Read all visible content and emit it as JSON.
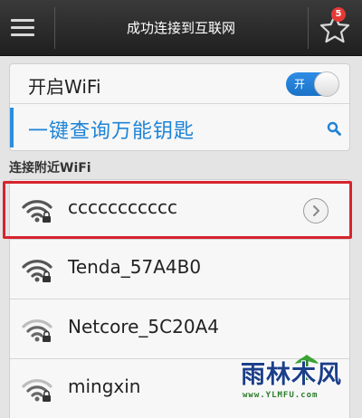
{
  "header": {
    "title": "成功连接到互联网",
    "favorites_count": "5"
  },
  "wifi_toggle": {
    "label": "开启WiFi",
    "state_text": "开",
    "enabled": true
  },
  "query": {
    "label": "一键查询万能钥匙"
  },
  "section": {
    "nearby_label": "连接附近WiFi"
  },
  "networks": [
    {
      "name": "ccccccccccc",
      "locked": true,
      "signal": "full",
      "highlighted": true
    },
    {
      "name": "Tenda_57A4B0",
      "locked": true,
      "signal": "full",
      "highlighted": false
    },
    {
      "name": "Netcore_5C20A4",
      "locked": true,
      "signal": "medium",
      "highlighted": false
    },
    {
      "name": "mingxin",
      "locked": true,
      "signal": "medium",
      "highlighted": false
    }
  ],
  "watermark": {
    "text": "雨林木风",
    "url": "www.YLMFU.com"
  },
  "colors": {
    "topbar": "#2b2b2b",
    "accent_blue": "#1e83d6",
    "highlight_red": "#d6242e",
    "badge_red": "#e53935"
  },
  "icons": [
    "menu-icon",
    "star-icon",
    "search-icon",
    "wifi-lock-icon",
    "chevron-right-icon"
  ]
}
